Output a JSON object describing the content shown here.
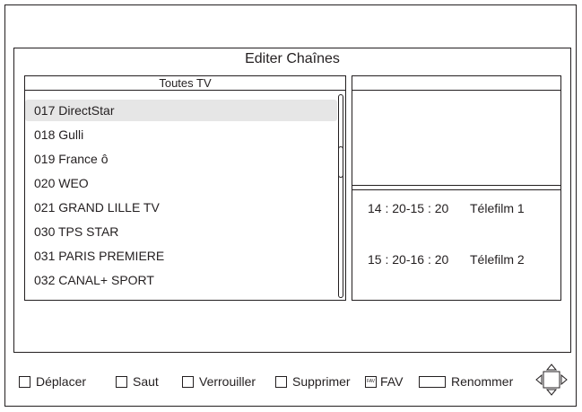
{
  "dialog": {
    "title": "Editer Chaînes"
  },
  "list": {
    "header": "Toutes TV",
    "channels": [
      "017 DirectStar",
      "018 Gulli",
      "019 France ô",
      "020 WEO",
      "021 GRAND LILLE TV",
      "030 TPS STAR",
      "031 PARIS PREMIERE",
      "032 CANAL+ SPORT"
    ],
    "selected_index": 0
  },
  "epg": [
    {
      "time": "14 : 20-15 : 20",
      "title": "Télefilm 1"
    },
    {
      "time": "15 : 20-16 : 20",
      "title": "Télefilm 2"
    }
  ],
  "footer": {
    "move": "Déplacer",
    "skip": "Saut",
    "lock": "Verrouiller",
    "delete": "Supprimer",
    "fav_key": "FAV",
    "fav": "FAV",
    "rename": "Renommer"
  }
}
